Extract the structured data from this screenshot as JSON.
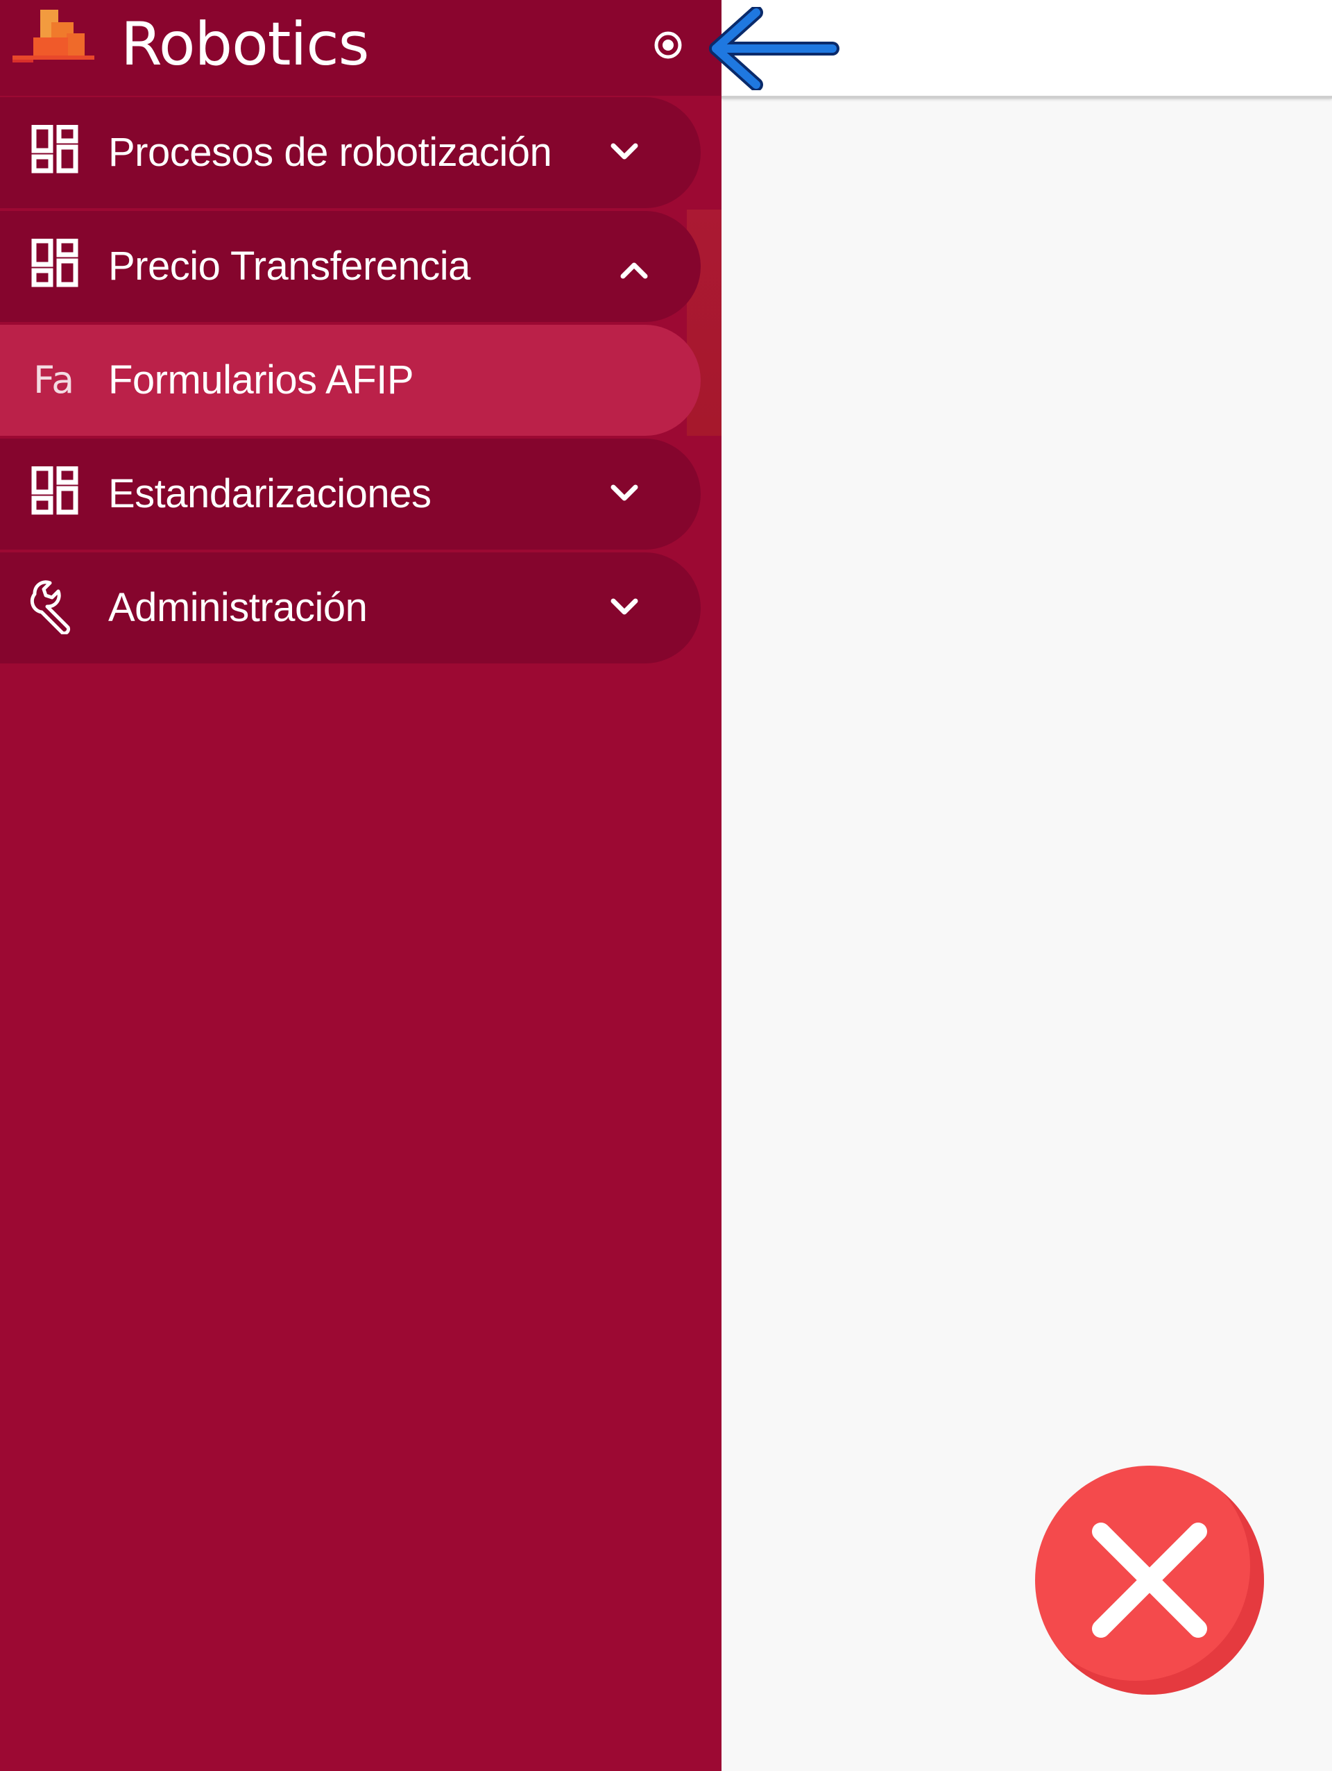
{
  "app": {
    "title": "Robotics"
  },
  "sidebar": {
    "items": [
      {
        "label": "Procesos de robotización",
        "icon": "dashboard-icon",
        "expanded": false
      },
      {
        "label": "Precio Transferencia",
        "icon": "dashboard-icon",
        "expanded": true,
        "children": [
          {
            "label": "Formularios AFIP",
            "badge": "Fa",
            "active": true
          }
        ]
      },
      {
        "label": "Estandarizaciones",
        "icon": "dashboard-icon",
        "expanded": false
      },
      {
        "label": "Administración",
        "icon": "wrench-icon",
        "expanded": false
      }
    ]
  },
  "colors": {
    "sidebar": "#9c0933",
    "item_bg": "#85052d",
    "active_item": "#bb2149",
    "annotation_arrow": "#1f78e0",
    "close_button": "#f44a4c"
  }
}
